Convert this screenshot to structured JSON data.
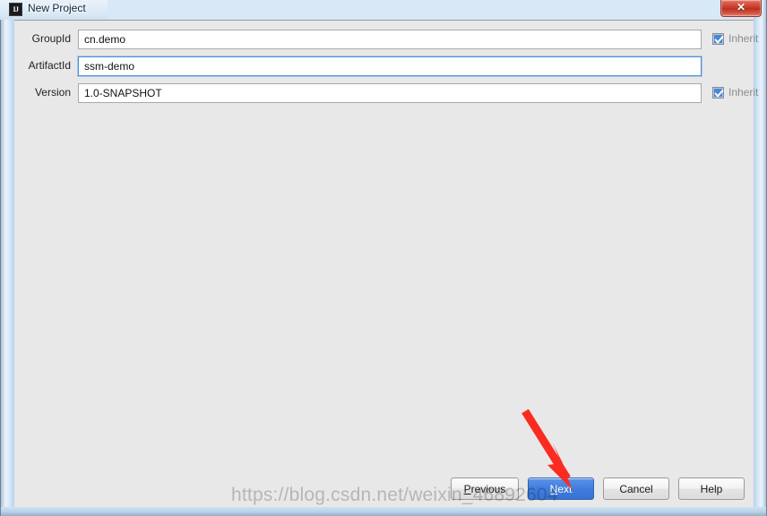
{
  "window": {
    "title": "New Project",
    "app_icon": "intellij-idea-icon",
    "icon_text": "IJ",
    "close_label": "✕",
    "accent_blue": "#3f7ddd",
    "frame_blue": "#cde1f3",
    "body_gray": "#e8e8e8"
  },
  "form": {
    "rows": [
      {
        "label": "GroupId",
        "value": "cn.demo",
        "placeholder": "",
        "focused": false,
        "inherit": {
          "label": "Inherit",
          "checked": true,
          "enabled": false
        }
      },
      {
        "label": "ArtifactId",
        "value": "ssm-demo",
        "placeholder": "",
        "focused": true,
        "inherit": null
      },
      {
        "label": "Version",
        "value": "1.0-SNAPSHOT",
        "placeholder": "",
        "focused": false,
        "inherit": {
          "label": "Inherit",
          "checked": true,
          "enabled": false
        }
      }
    ]
  },
  "footer": {
    "buttons": [
      {
        "name": "previous-button",
        "label": "Previous",
        "mnemonic": "P",
        "primary": false
      },
      {
        "name": "next-button",
        "label": "Next",
        "mnemonic": "N",
        "primary": true
      },
      {
        "name": "cancel-button",
        "label": "Cancel",
        "mnemonic": "",
        "primary": false
      },
      {
        "name": "help-button",
        "label": "Help",
        "mnemonic": "",
        "primary": false
      }
    ]
  },
  "annotation": {
    "arrow_color": "#fb2b20",
    "arrow_target": "next-button"
  },
  "watermark": {
    "text": "https://blog.csdn.net/weixin_46892604"
  }
}
